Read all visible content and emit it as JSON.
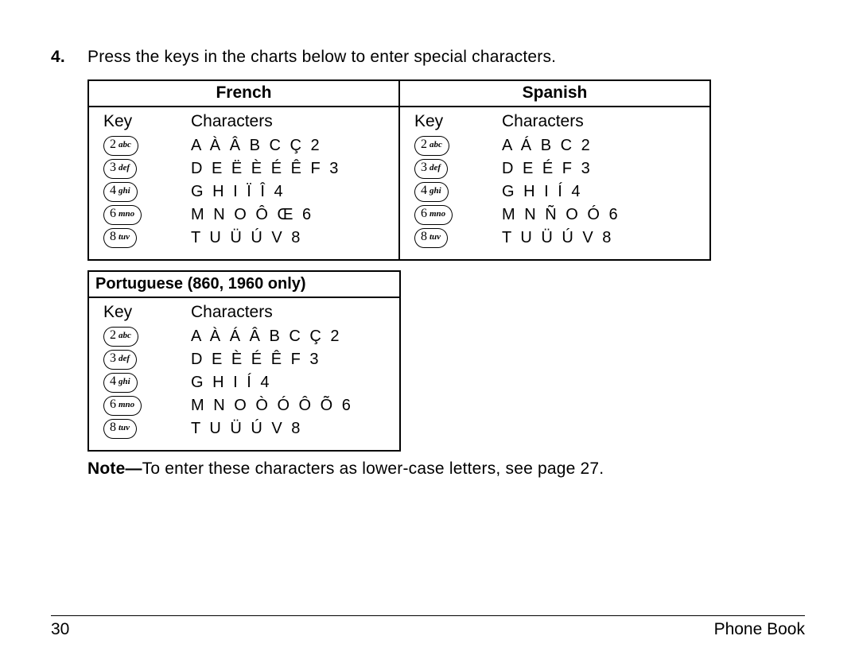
{
  "instruction": {
    "number": "4.",
    "text": "Press the keys in the charts below to enter special characters."
  },
  "keys": {
    "k2": {
      "digit": "2",
      "letters": "abc"
    },
    "k3": {
      "digit": "3",
      "letters": "def"
    },
    "k4": {
      "digit": "4",
      "letters": "ghi"
    },
    "k6": {
      "digit": "6",
      "letters": "mno"
    },
    "k8": {
      "digit": "8",
      "letters": "tuv"
    }
  },
  "col_key": "Key",
  "col_chars": "Characters",
  "french": {
    "title": "French",
    "rows": {
      "r0": "A À Â B C Ç 2",
      "r1": "D E Ë È É Ê F 3",
      "r2": "G H I Ï Î 4",
      "r3": "M N O Ô Œ 6",
      "r4": "T U Ü Ú V 8"
    }
  },
  "spanish": {
    "title": "Spanish",
    "rows": {
      "r0": "A Á B C 2",
      "r1": "D E É F 3",
      "r2": "G H I Í 4",
      "r3": "M N Ñ O Ó 6",
      "r4": "T U Ü Ú V 8"
    }
  },
  "portuguese": {
    "title": "Portuguese (860, 1960 only)",
    "rows": {
      "r0": "A À Á Â B C Ç 2",
      "r1": "D E È É Ê F 3",
      "r2": "G H I Í 4",
      "r3": "M N O Ò Ó Ô Õ 6",
      "r4": "T U Ü Ú V 8"
    }
  },
  "note": {
    "label": "Note—",
    "text": "To enter these characters as lower-case letters, see page 27."
  },
  "footer": {
    "page": "30",
    "section": "Phone Book"
  }
}
